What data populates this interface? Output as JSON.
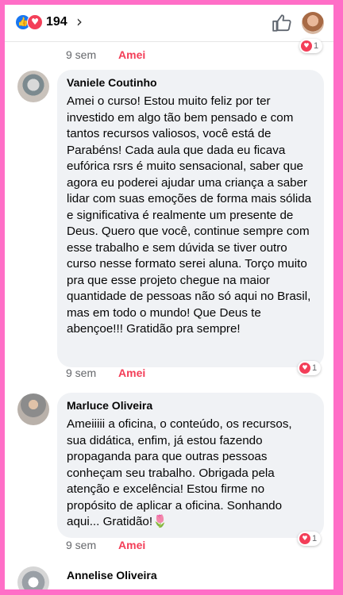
{
  "header": {
    "reaction_count": "194",
    "icons": [
      "like-icon",
      "love-icon",
      "chevron-right-icon",
      "thumbs-up-icon"
    ]
  },
  "colors": {
    "border": "#ff6ec7",
    "love": "#f33e58",
    "like": "#1877f2",
    "bubble": "#f0f2f5"
  },
  "comments": [
    {
      "time": "9 sem",
      "action": "Amei",
      "reactions": "1"
    },
    {
      "name": "Vaniele Coutinho",
      "text": "Amei o curso! Estou muito feliz por ter investido em algo tão bem pensado e com tantos recursos valiosos, você está de Parabéns! Cada aula que dada eu ficava eufórica rsrs é muito sensacional, saber que agora eu poderei ajudar uma criança a saber lidar com suas emoções de forma mais sólida e significativa é realmente um presente de Deus. Quero que você, continue sempre com esse trabalho e sem dúvida se tiver outro curso nesse formato serei aluna. Torço muito pra que esse projeto chegue na maior quantidade de pessoas não só aqui no Brasil, mas em todo o mundo! Que Deus te abençoe!!! Gratidão pra sempre!",
      "time": "9 sem",
      "action": "Amei",
      "reactions": "1"
    },
    {
      "name": "Marluce Oliveira",
      "text": "Ameiiiii a oficina, o conteúdo, os recursos, sua didática, enfim, já estou fazendo propaganda para que outras pessoas conheçam seu trabalho. Obrigada pela atenção e excelência! Estou firme no propósito de aplicar a oficina. Sonhando aqui... Gratidão!🌷",
      "time": "9 sem",
      "action": "Amei",
      "reactions": "1"
    },
    {
      "name": "Annelise Oliveira"
    }
  ]
}
